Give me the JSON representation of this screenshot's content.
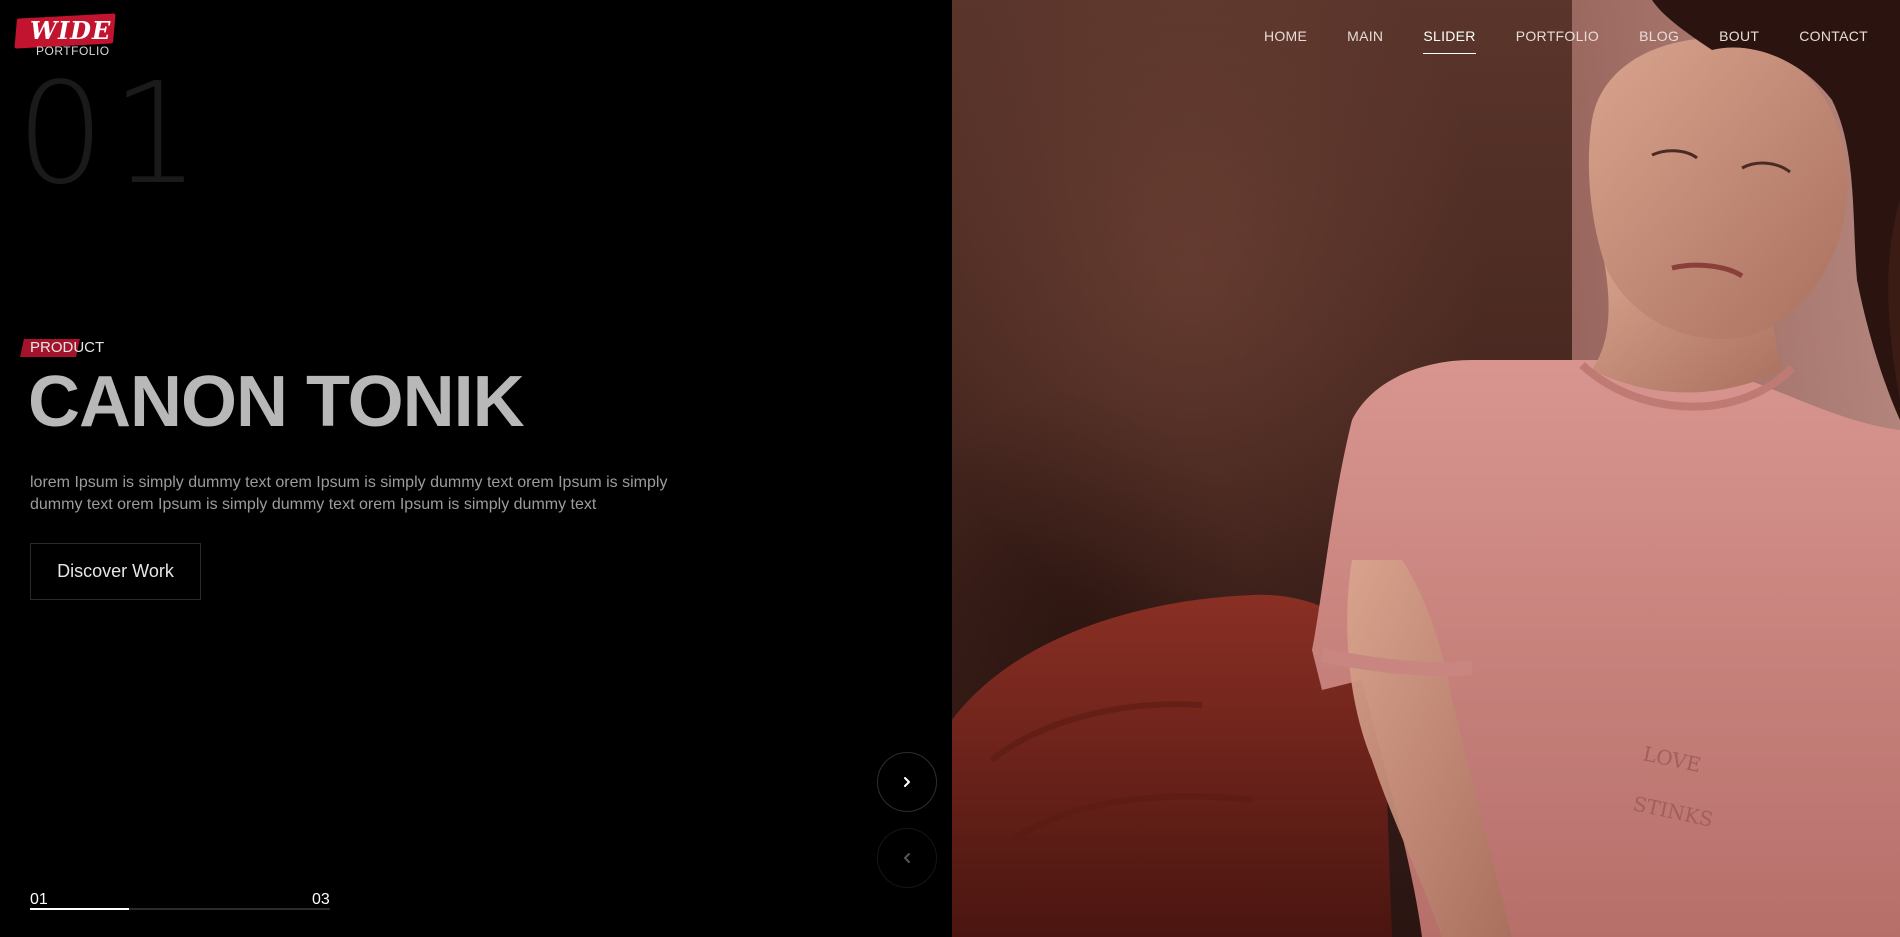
{
  "logo": {
    "text": "WIDE",
    "subtext": "PORTFOLIO"
  },
  "nav": {
    "items": [
      {
        "label": "HOME",
        "active": false
      },
      {
        "label": "MAIN",
        "active": false
      },
      {
        "label": "SLIDER",
        "active": true
      },
      {
        "label": "PORTFOLIO",
        "active": false
      },
      {
        "label": "BLOG",
        "active": false
      },
      {
        "label": "BOUT",
        "active": false
      },
      {
        "label": "CONTACT",
        "active": false
      }
    ]
  },
  "slide": {
    "number": "01",
    "tag": "PRODUCT",
    "title": "CANON TONIK",
    "description": "lorem Ipsum is simply dummy text orem Ipsum is simply dummy text orem Ipsum is simply dummy text orem Ipsum is simply dummy text orem Ipsum is simply dummy text",
    "cta_label": "Discover Work"
  },
  "arrows": {
    "next_icon": "chevron-right-icon",
    "prev_icon": "chevron-left-icon"
  },
  "pagination": {
    "current": "01",
    "total": "03",
    "progress": 0.33
  },
  "colors": {
    "accent": "#c2142f",
    "background": "#000000",
    "title": "#b8b8b8"
  }
}
